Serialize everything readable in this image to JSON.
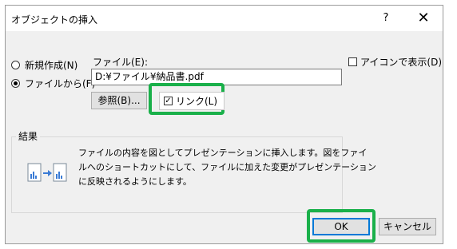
{
  "dialog": {
    "title": "オブジェクトの挿入",
    "help_label": "?",
    "close_label": "✕"
  },
  "options": {
    "new_label": "新規作成(N)",
    "from_file_label": "ファイルから(F)",
    "selected": "from_file"
  },
  "file": {
    "label": "ファイル(E):",
    "path": "D:¥ファイル¥納品書.pdf",
    "browse_label": "参照(B)...",
    "link_label": "リンク(L)",
    "link_checked": true
  },
  "display_as_icon": {
    "label": "アイコンで表示(D)",
    "checked": false
  },
  "result": {
    "heading": "結果",
    "lines": [
      "ファイルの内容を図としてプレゼンテーションに挿入します。図をファイ",
      "ルへのショートカットにして、ファイルに加えた変更がプレゼンテーション",
      "に反映されるようにします。"
    ]
  },
  "buttons": {
    "ok_label": "OK",
    "cancel_label": "キャンセル"
  },
  "colors": {
    "highlight": "#1ab04a",
    "default_button_border": "#0078d7"
  }
}
